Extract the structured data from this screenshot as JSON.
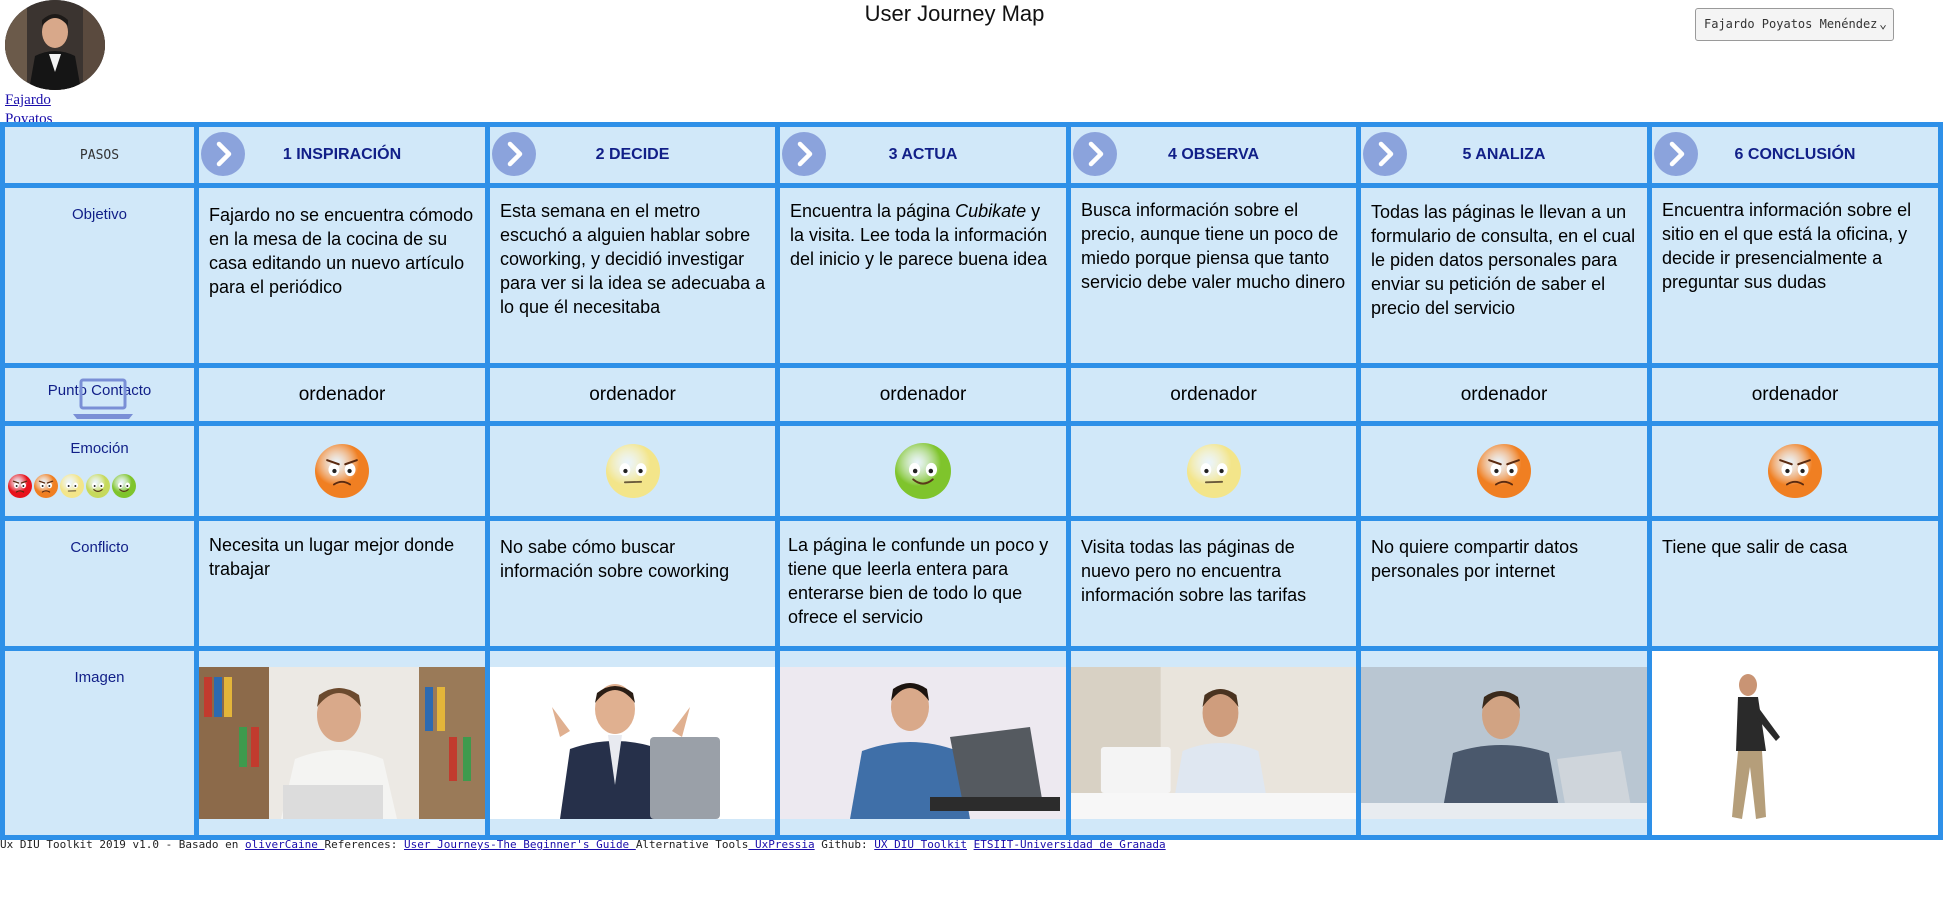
{
  "header": {
    "title": "User Journey Map",
    "user_link": "Fajardo Poyatos Menéndez",
    "user_select": "Fajardo Poyatos Menéndez"
  },
  "rows": {
    "pasos": "PASOS",
    "objetivo": "Objetivo",
    "punto_contacto": "Punto Contacto",
    "emocion": "Emoción",
    "conflicto": "Conflicto",
    "imagen": "Imagen"
  },
  "emotion_scale": [
    "very-angry",
    "angry",
    "neutral",
    "happy",
    "very-happy"
  ],
  "steps": [
    {
      "title": "1 INSPIRACIÓN",
      "objective": "Fajardo no se encuentra cómodo en la mesa de la cocina de su casa editando un nuevo artículo para el periódico",
      "contact": "ordenador",
      "emotion": "angry",
      "conflict": "Necesita un lugar mejor donde trabajar"
    },
    {
      "title": "2 DECIDE",
      "objective": "Esta semana en el metro escuchó a alguien hablar sobre coworking, y decidió investigar para ver si la idea se adecuaba a lo que él necesitaba",
      "contact": "ordenador",
      "emotion": "neutral",
      "conflict": "No sabe cómo buscar información sobre coworking"
    },
    {
      "title": "3 ACTUA",
      "objective_before": "Encuentra la página ",
      "objective_em": "Cubikate",
      "objective_after": " y la visita. Lee toda la información del inicio y le parece buena idea",
      "contact": "ordenador",
      "emotion": "very-happy",
      "conflict": "La página le confunde un poco y tiene que leerla entera para enterarse bien de todo lo que ofrece el servicio"
    },
    {
      "title": "4 OBSERVA",
      "objective": "Busca información sobre el precio, aunque tiene un poco de miedo porque piensa que tanto servicio debe valer mucho dinero",
      "contact": "ordenador",
      "emotion": "neutral",
      "conflict": "Visita todas las páginas de nuevo pero no encuentra información sobre las tarifas"
    },
    {
      "title": "5 ANALIZA",
      "objective": "Todas las páginas le llevan a un formulario de consulta, en el cual le piden datos personales para enviar su petición de saber el precio del servicio",
      "contact": "ordenador",
      "emotion": "angry",
      "conflict": "No quiere compartir datos personales por internet"
    },
    {
      "title": "6 CONCLUSIÓN",
      "objective": "Encuentra información sobre el sitio en el que está la oficina, y decide ir presencialmente a preguntar sus dudas",
      "contact": "ordenador",
      "emotion": "angry",
      "conflict": "Tiene que salir de casa"
    }
  ],
  "emotion_colors": {
    "very-angry": "#e8131d",
    "angry": "#f07f22",
    "neutral": "#f3e58a",
    "happy": "#c6d95c",
    "very-happy": "#7fc42c"
  },
  "footer": {
    "text1": "Ux DIU Toolkit 2019 v1.0 - Basado en ",
    "link1": "oliverCaine ",
    "text2": "   References: ",
    "link2": "User Journeys-The Beginner's Guide ",
    "text3": "   Alternative Tools",
    "link3": " UxPressia",
    "text4": " Github: ",
    "link4": "UX DIU Toolkit",
    "text5": " ",
    "link5": "ETSIIT-Universidad de Granada"
  }
}
